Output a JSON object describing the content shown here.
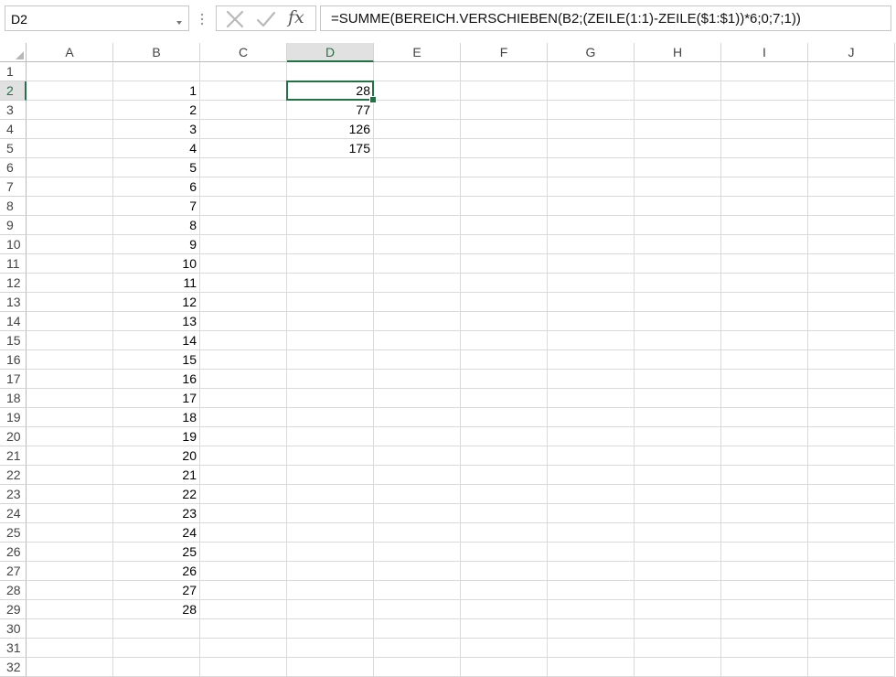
{
  "formula_bar": {
    "name_box": "D2",
    "formula": "=SUMME(BEREICH.VERSCHIEBEN(B2;(ZEILE(1:1)-ZEILE($1:$1))*6;0;7;1))",
    "cancel_icon": "cancel-x-icon",
    "enter_icon": "enter-check-icon",
    "function_icon": "fx-icon",
    "function_label": "fx"
  },
  "sheet": {
    "columns": [
      "A",
      "B",
      "C",
      "D",
      "E",
      "F",
      "G",
      "H",
      "I",
      "J"
    ],
    "rows": [
      "1",
      "2",
      "3",
      "4",
      "5",
      "6",
      "7",
      "8",
      "9",
      "10",
      "11",
      "12",
      "13",
      "14",
      "15",
      "16",
      "17",
      "18",
      "19",
      "20",
      "21",
      "22",
      "23",
      "24",
      "25",
      "26",
      "27",
      "28",
      "29",
      "30",
      "31",
      "32"
    ],
    "selected_cell": "D2",
    "selected_column": "D",
    "selected_row": "2",
    "accent_color": "#217346",
    "cells": {
      "B": [
        "",
        "1",
        "2",
        "3",
        "4",
        "5",
        "6",
        "7",
        "8",
        "9",
        "10",
        "11",
        "12",
        "13",
        "14",
        "15",
        "16",
        "17",
        "18",
        "19",
        "20",
        "21",
        "22",
        "23",
        "24",
        "25",
        "26",
        "27",
        "28",
        "",
        "",
        " "
      ],
      "D": [
        "",
        "28",
        "77",
        "126",
        "175"
      ]
    }
  }
}
